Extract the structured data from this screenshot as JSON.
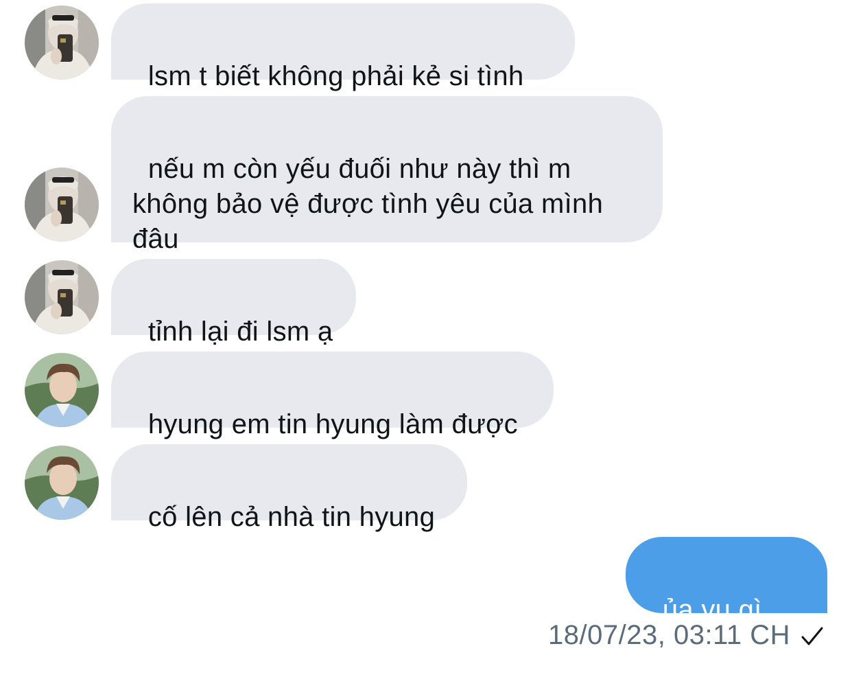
{
  "conversation": {
    "messages": [
      {
        "sender": "contact_a",
        "text": "lsm t biết không phải kẻ si tình"
      },
      {
        "sender": "contact_a",
        "text": "nếu m còn yếu đuối như này thì m\nkhông bảo vệ được tình yêu của mình\nđâu"
      },
      {
        "sender": "contact_a",
        "text": "tỉnh lại đi lsm ạ"
      },
      {
        "sender": "contact_b",
        "text": "hyung em tin hyung làm được"
      },
      {
        "sender": "contact_b",
        "text": "cố lên cả nhà tin hyung"
      },
      {
        "sender": "me",
        "text": "ủa vụ gì vậy"
      }
    ],
    "timestamp": "18/07/23, 03:11 CH",
    "read_status_icon": "checkmark-icon"
  },
  "colors": {
    "incoming_bubble": "#e7e9ee",
    "outgoing_bubble": "#4c9ee8",
    "timestamp_text": "#5b6b7a"
  }
}
